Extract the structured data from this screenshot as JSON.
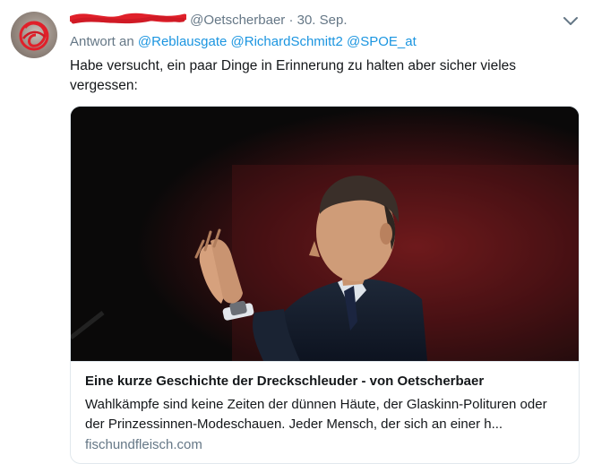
{
  "tweet": {
    "display_name": "",
    "handle": "@Oetscherbaer",
    "separator": "·",
    "time": "30. Sep.",
    "reply_prefix": "Antwort an",
    "reply_mentions": [
      "@Reblausgate",
      "@RichardSchmitt2",
      "@SPOE_at"
    ],
    "text": "Habe versucht, ein paar Dinge in Erinnerung zu halten aber sicher vieles vergessen:"
  },
  "card": {
    "title": "Eine kurze Geschichte der Dreckschleuder - von Oetscherbaer",
    "description": "Wahlkämpfe sind keine Zeiten der dünnen Häute, der Glaskinn-Polituren oder der Prinzessinnen-Modeschauen. Jeder Mensch, der sich an einer h...",
    "domain": "fischundfleisch.com"
  },
  "icons": {
    "caret": "chevron-down-icon",
    "avatar": "avatar"
  },
  "colors": {
    "secondary_text": "#657786",
    "link": "#1b95e0",
    "redaction": "#e0202a",
    "border": "#e1e8ed"
  }
}
